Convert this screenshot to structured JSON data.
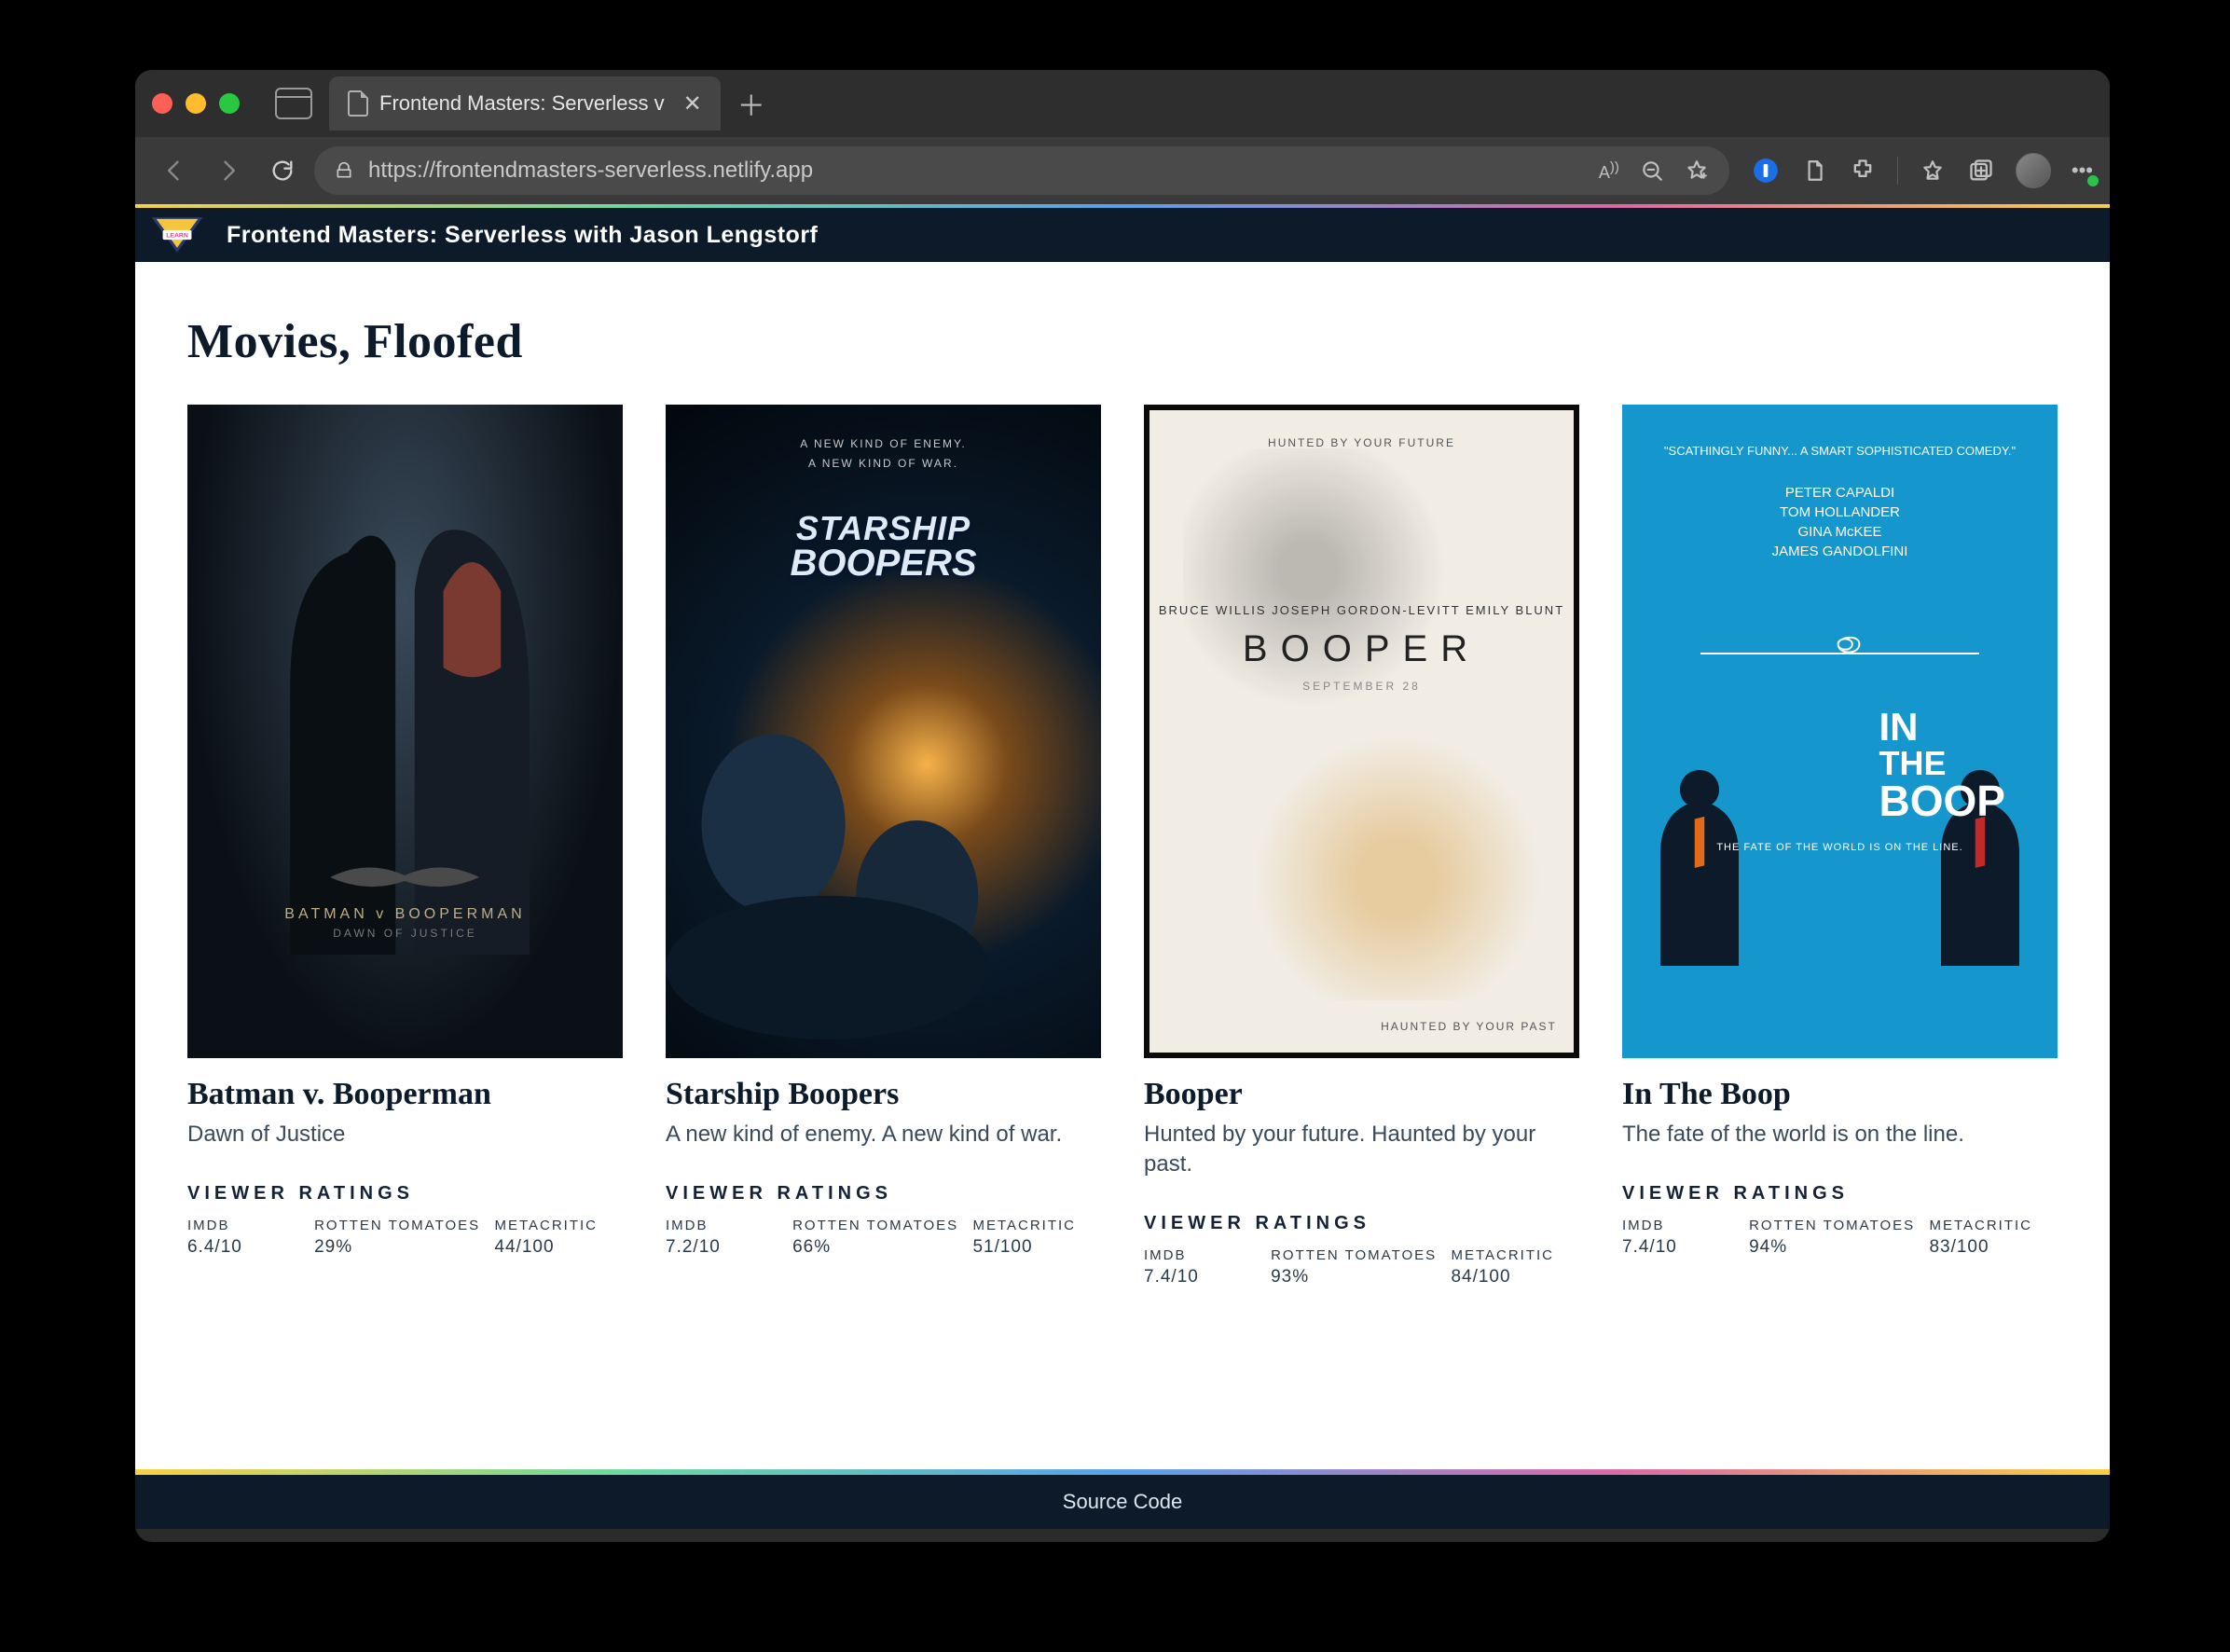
{
  "browser": {
    "tab_title": "Frontend Masters: Serverless v",
    "url": "https://frontendmasters-serverless.netlify.app"
  },
  "site": {
    "header_title": "Frontend Masters: Serverless with Jason Lengstorf",
    "footer_link": "Source Code"
  },
  "page": {
    "heading": "Movies, Floofed",
    "ratings_heading": "VIEWER RATINGS",
    "rating_sources": {
      "imdb": "IMDB",
      "rt": "ROTTEN TOMATOES",
      "mc": "METACRITIC"
    }
  },
  "movies": [
    {
      "title": "Batman v. Booperman",
      "tagline": "Dawn of Justice",
      "poster": {
        "title_line": "BATMAN v BOOPERMAN",
        "subtitle": "DAWN OF JUSTICE"
      },
      "ratings": {
        "imdb": "6.4/10",
        "rt": "29%",
        "mc": "44/100"
      }
    },
    {
      "title": "Starship Boopers",
      "tagline": "A new kind of enemy. A new kind of war.",
      "poster": {
        "tag1": "A NEW KIND OF ENEMY.",
        "tag2": "A NEW KIND OF WAR.",
        "line1": "STARSHIP",
        "line2": "BOOPERS"
      },
      "ratings": {
        "imdb": "7.2/10",
        "rt": "66%",
        "mc": "51/100"
      }
    },
    {
      "title": "Booper",
      "tagline": "Hunted by your future. Haunted by your past.",
      "poster": {
        "top": "HUNTED BY YOUR FUTURE",
        "cast": "BRUCE WILLIS   JOSEPH GORDON-LEVITT   EMILY BLUNT",
        "title": "BOOPER",
        "date": "SEPTEMBER 28",
        "bottom": "HAUNTED BY YOUR PAST"
      },
      "ratings": {
        "imdb": "7.4/10",
        "rt": "93%",
        "mc": "84/100"
      }
    },
    {
      "title": "In The Boop",
      "tagline": "The fate of the world is on the line.",
      "poster": {
        "quote": "\"SCATHINGLY FUNNY... A SMART SOPHISTICATED COMEDY.\"",
        "cast": "PETER CAPALDI\nTOM HOLLANDER\nGINA McKEE\nJAMES GANDOLFINI",
        "w1": "IN",
        "w2": "THE",
        "w3": "BOOP",
        "sub": "THE FATE OF THE WORLD IS ON THE LINE."
      },
      "ratings": {
        "imdb": "7.4/10",
        "rt": "94%",
        "mc": "83/100"
      }
    }
  ]
}
